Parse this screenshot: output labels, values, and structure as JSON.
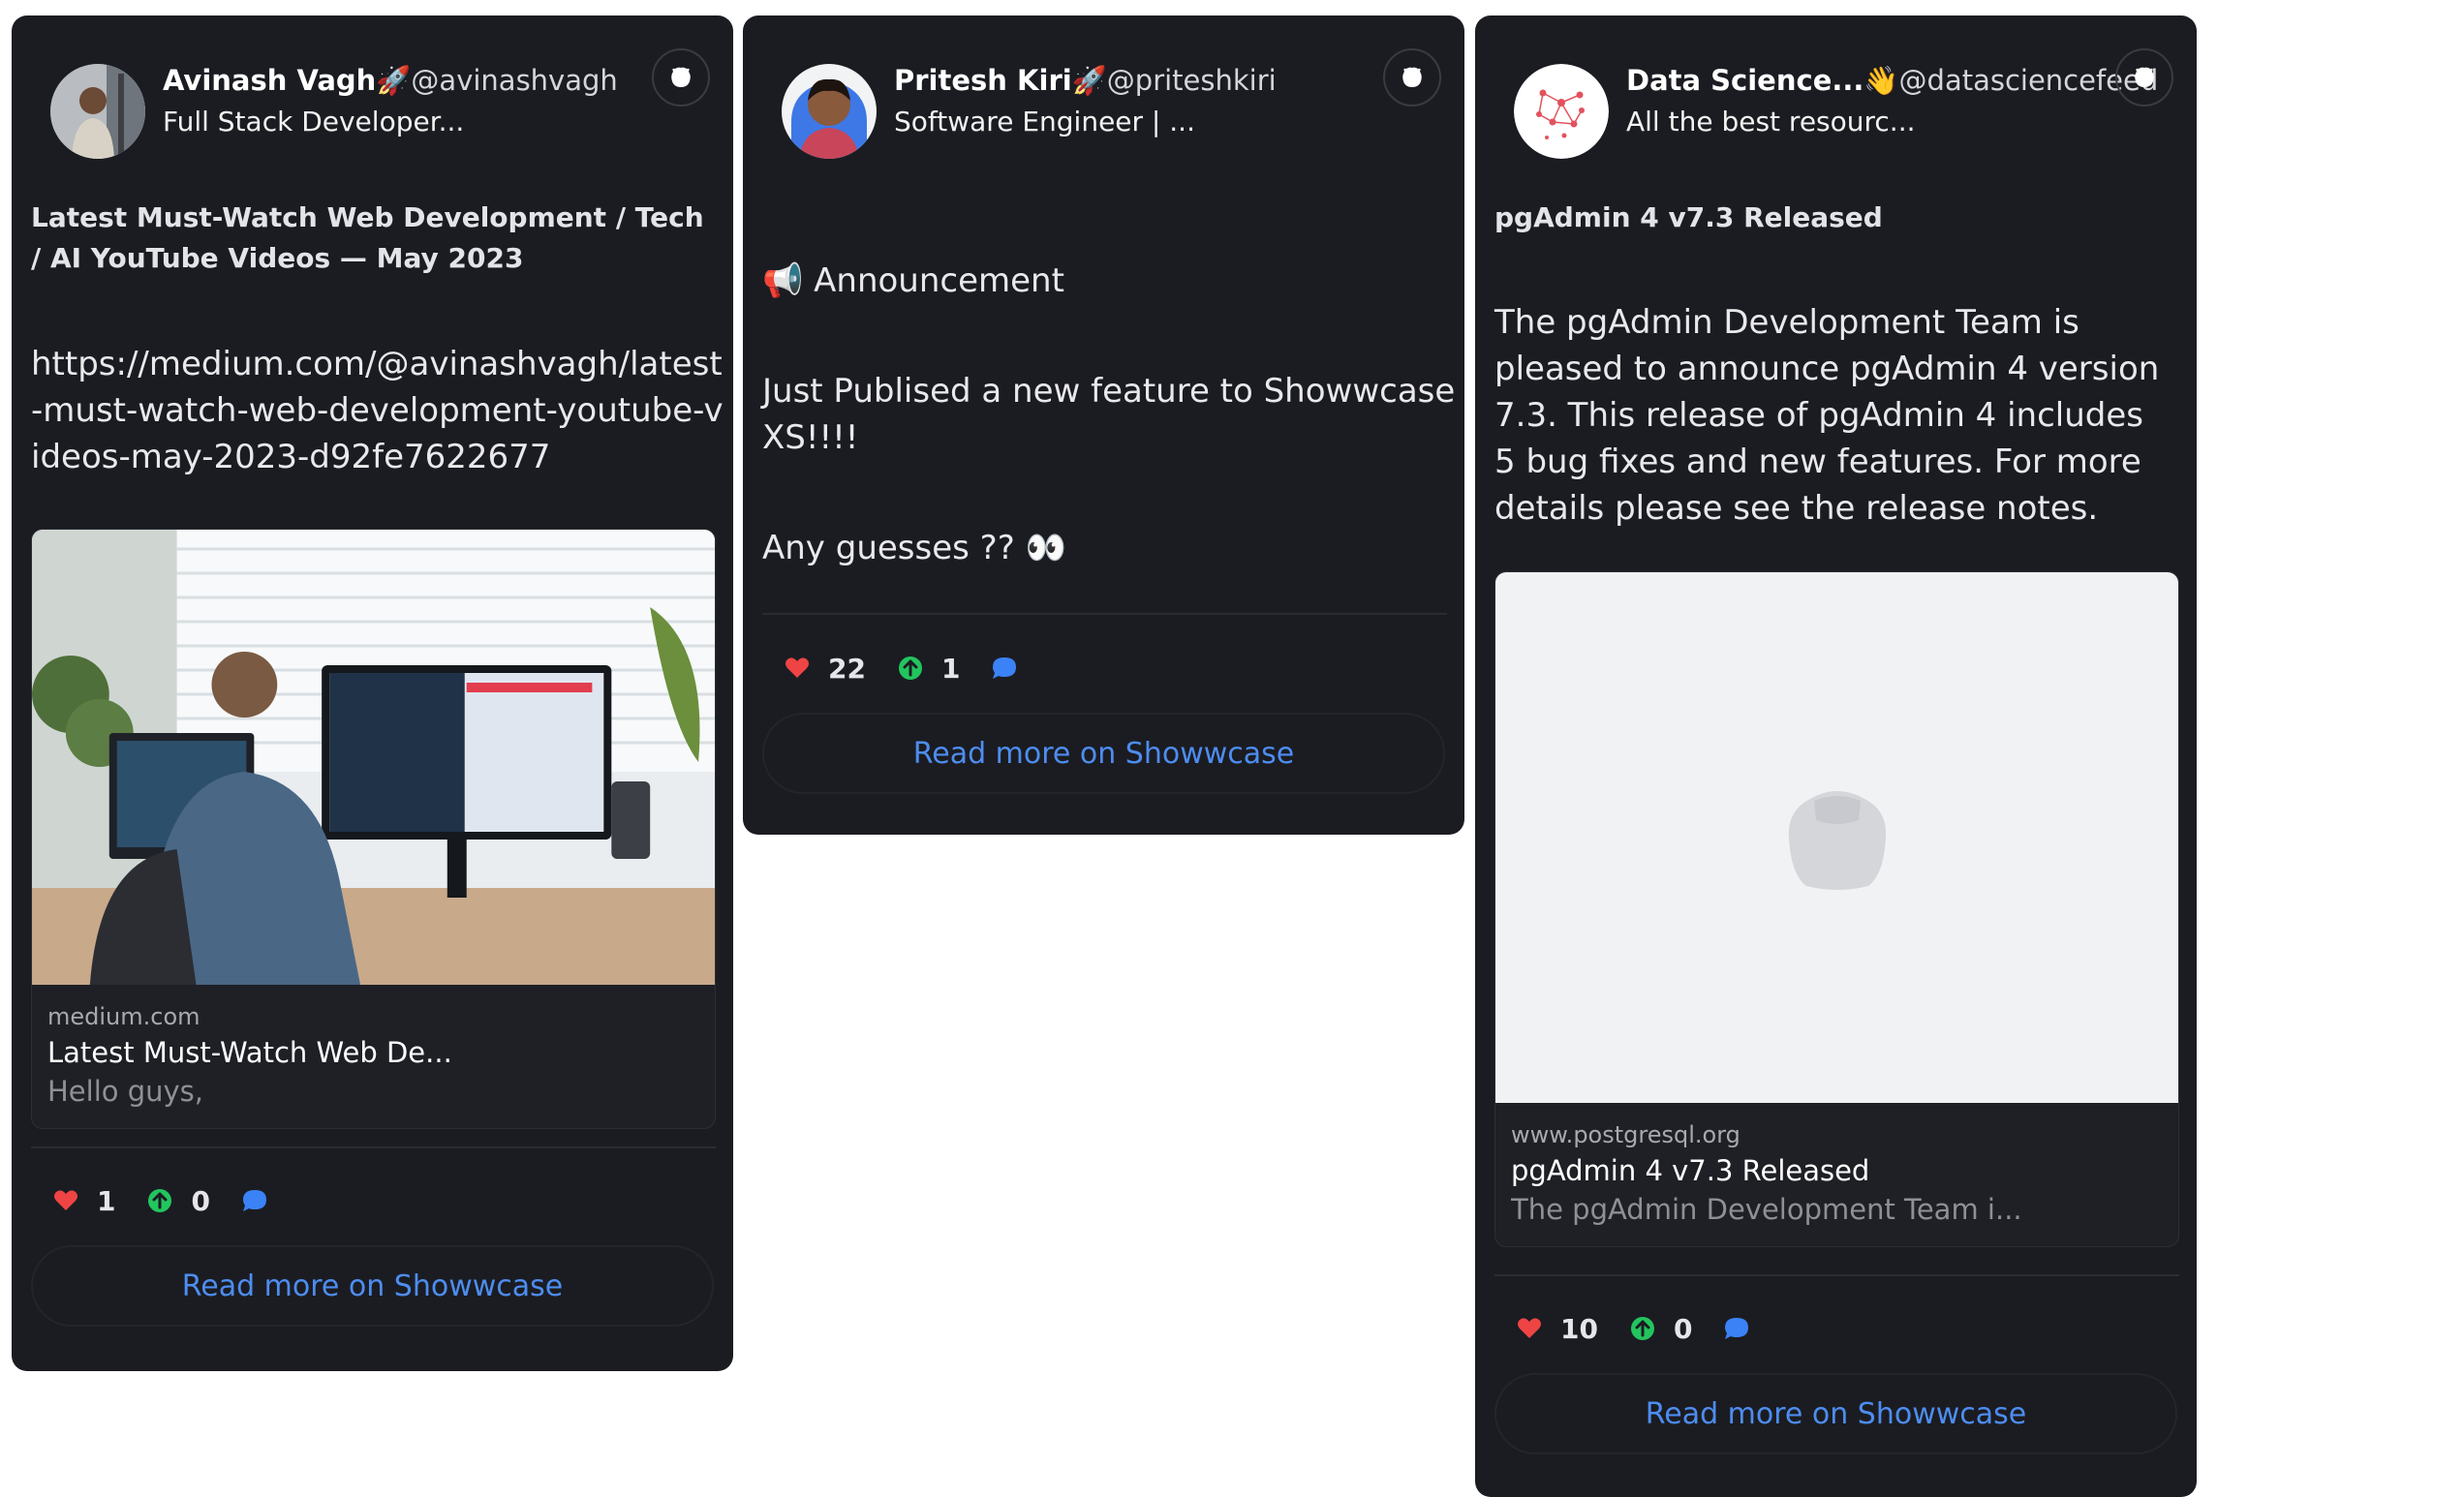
{
  "cards": [
    {
      "author_name": "Avinash Vagh🚀",
      "handle": "@avinashvagh",
      "bio": "Full Stack Developer...",
      "title": "Latest Must-Watch Web Development / Tech / AI YouTube Videos — May 2023",
      "body": [
        "https://medium.com/@avinashvagh/latest-must-watch-web-development-youtube-videos-may-2023-d92fe7622677"
      ],
      "preview": {
        "domain": "medium.com",
        "title": "Latest Must-Watch Web De...",
        "description": "Hello guys,"
      },
      "likes": "1",
      "upvotes": "0",
      "read_more": "Read more on Showwcase"
    },
    {
      "author_name": "Pritesh Kiri🚀",
      "handle": "@priteshkiri",
      "bio": "Software Engineer | ...",
      "body": [
        "📢 Announcement",
        "Just Publised a new feature to ShowwcaseXS!!!!",
        "Any guesses ?? 👀"
      ],
      "likes": "22",
      "upvotes": "1",
      "read_more": "Read more on Showwcase"
    },
    {
      "author_name": "Data Science...👋",
      "handle": "@datasciencefeed",
      "bio": "All the best resourc...",
      "title": "pgAdmin 4 v7.3 Released",
      "body": [
        "The pgAdmin Development Team is pleased to announce pgAdmin 4 version 7.3. This release of pgAdmin 4 includes 5 bug fixes and new features. For more details please see the release notes."
      ],
      "preview": {
        "domain": "www.postgresql.org",
        "title": "pgAdmin 4 v7.3 Released",
        "description": "The pgAdmin Development Team i..."
      },
      "likes": "10",
      "upvotes": "0",
      "read_more": "Read more on Showwcase"
    }
  ],
  "colors": {
    "card_bg": "#1b1c22",
    "heart": "#ef4444",
    "upvote": "#22c55e",
    "comment": "#3b82f6",
    "link": "#4d8df0"
  },
  "icons": [
    "showwcase-logo-icon",
    "heart-icon",
    "upvote-icon",
    "comment-icon",
    "bag-placeholder-icon"
  ]
}
